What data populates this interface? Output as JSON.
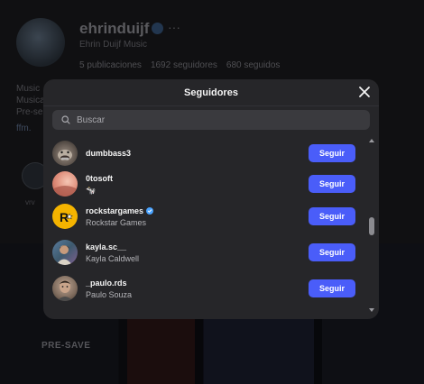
{
  "background": {
    "username": "ehrinduijf",
    "more": "···",
    "fullname": "Ehrin Duijf Music",
    "stats": [
      "5 publicaciones",
      "1692 seguidores",
      "680 seguidos"
    ],
    "bio_lines": [
      "Music",
      "Musica",
      "Pre-se"
    ],
    "link": "ffm.",
    "highlight_label": "vrv",
    "presave": "PRE-SAVE"
  },
  "modal": {
    "title": "Seguidores",
    "search": {
      "placeholder": "Buscar",
      "value": ""
    },
    "follow_label": "Seguir",
    "followers": [
      {
        "username": "dumbbass3",
        "fullname": "",
        "verified": false,
        "avatar": "dog-photo"
      },
      {
        "username": "0tosoft",
        "fullname": "🐄",
        "verified": false,
        "avatar": "pink-gradient"
      },
      {
        "username": "rockstargames",
        "fullname": "Rockstar Games",
        "verified": true,
        "avatar": "rockstar-logo"
      },
      {
        "username": "kayla.sc__",
        "fullname": "Kayla Caldwell",
        "verified": false,
        "avatar": "person-photo"
      },
      {
        "username": "_paulo.rds",
        "fullname": "Paulo Souza",
        "verified": false,
        "avatar": "person-photo"
      }
    ]
  },
  "colors": {
    "accent": "#4a5df9",
    "modal_bg": "#262629",
    "verified": "#4aa3ff"
  }
}
